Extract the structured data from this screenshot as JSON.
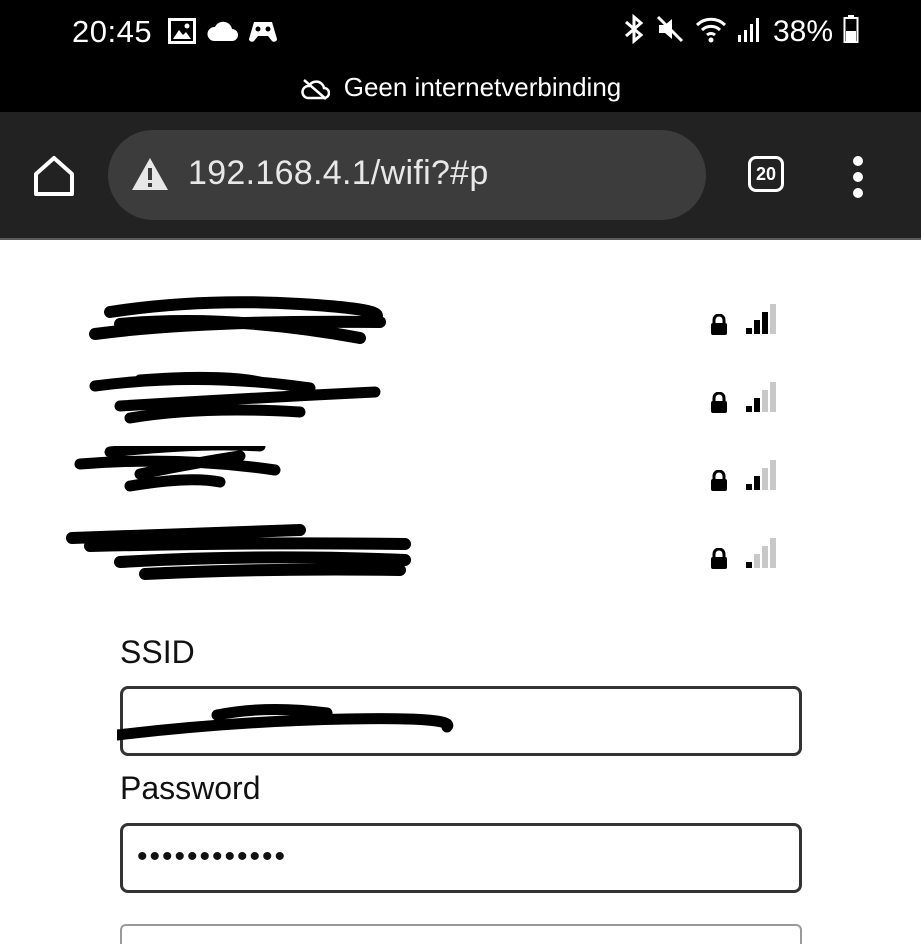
{
  "status_bar": {
    "time": "20:45",
    "left_icons": [
      "image-icon",
      "cloud-icon",
      "game-controller-icon"
    ],
    "right_icons": [
      "bluetooth-icon",
      "muted-icon",
      "wifi-icon",
      "cell-signal-icon",
      "battery-icon"
    ],
    "battery_percent": "38%",
    "notice_icon": "cloud-off-icon",
    "notice": "Geen internetverbinding"
  },
  "browser": {
    "url": "192.168.4.1/wifi?#p",
    "security_icon": "warning-icon",
    "tab_count": "20"
  },
  "networks": [
    {
      "name": "",
      "secured": true,
      "signal_bars": 3
    },
    {
      "name": "",
      "secured": true,
      "signal_bars": 2
    },
    {
      "name": "",
      "secured": true,
      "signal_bars": 2
    },
    {
      "name": "",
      "secured": true,
      "signal_bars": 1
    }
  ],
  "form": {
    "ssid_label": "SSID",
    "ssid_value": "",
    "password_label": "Password",
    "password_value": "••••••••••••"
  },
  "colors": {
    "statusbar_bg": "#000000",
    "toolbar_bg": "#222222",
    "omnibox_bg": "#3c3c3c",
    "signal_active": "#000000",
    "signal_inactive": "#c8c8c8"
  }
}
